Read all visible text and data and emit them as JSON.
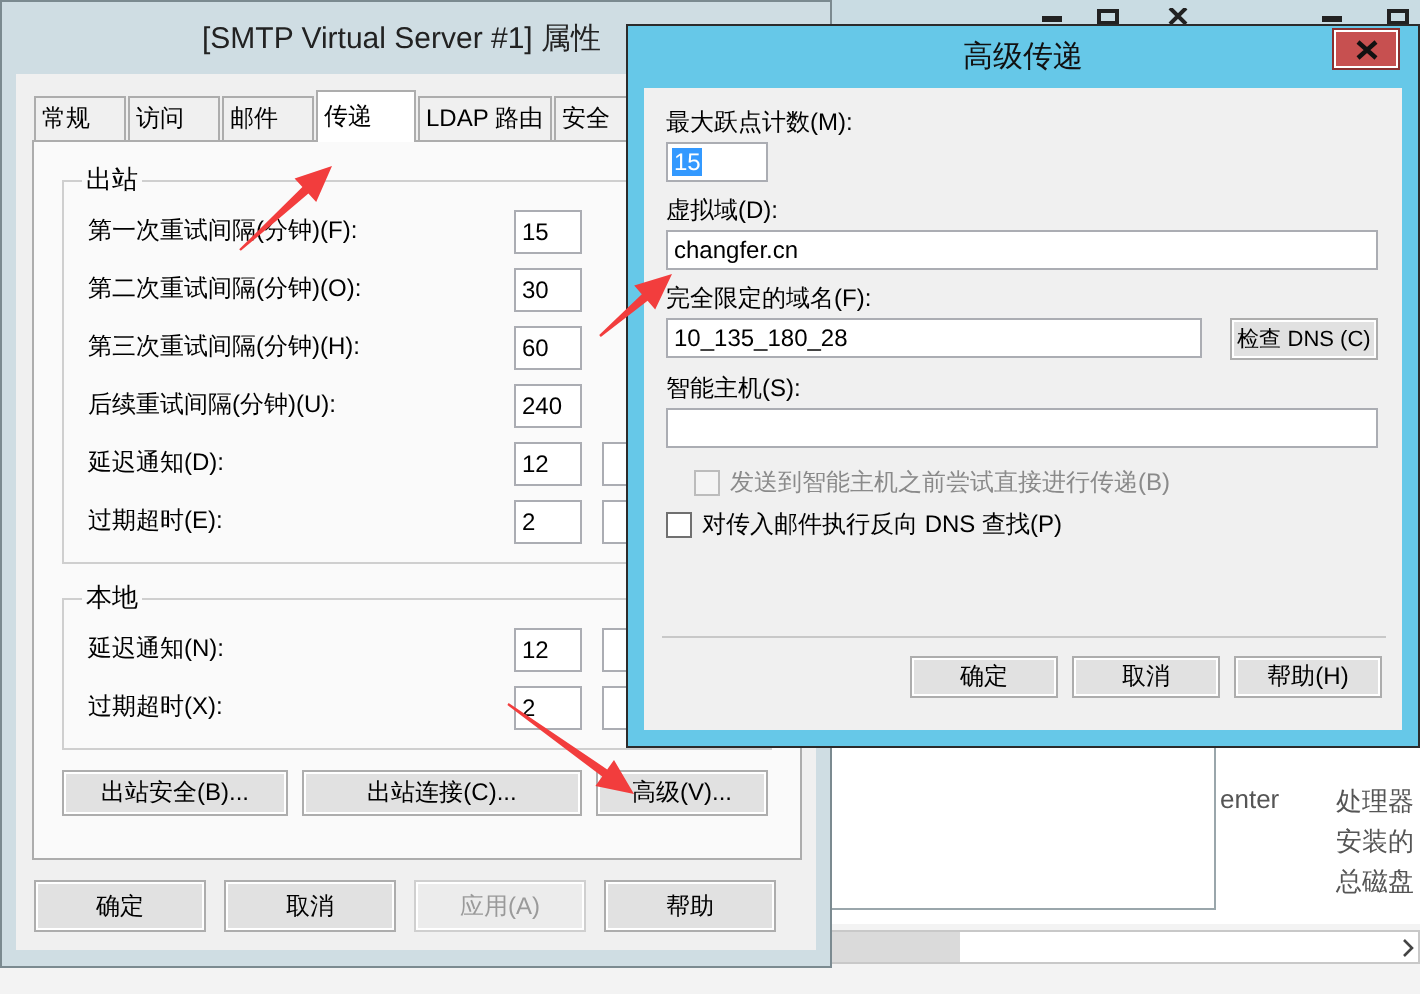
{
  "background_window": {
    "texts": [
      "enter",
      "处理器",
      "安装的",
      "总磁盘"
    ]
  },
  "properties_dialog": {
    "title": "[SMTP Virtual Server #1] 属性",
    "tabs": [
      {
        "label": "常规",
        "selected": false
      },
      {
        "label": "访问",
        "selected": false
      },
      {
        "label": "邮件",
        "selected": false
      },
      {
        "label": "传递",
        "selected": true
      },
      {
        "label": "LDAP 路由",
        "selected": false
      },
      {
        "label": "安全",
        "selected": false
      }
    ],
    "groups": [
      {
        "title": "出站",
        "rows": [
          {
            "label": "第一次重试间隔(分钟)(F):",
            "value": "15",
            "dropdown": false
          },
          {
            "label": "第二次重试间隔(分钟)(O):",
            "value": "30",
            "dropdown": false
          },
          {
            "label": "第三次重试间隔(分钟)(H):",
            "value": "60",
            "dropdown": false
          },
          {
            "label": "后续重试间隔(分钟)(U):",
            "value": "240",
            "dropdown": false
          },
          {
            "label": "延迟通知(D):",
            "value": "12",
            "dropdown": true
          },
          {
            "label": "过期超时(E):",
            "value": "2",
            "dropdown": true
          }
        ]
      },
      {
        "title": "本地",
        "rows": [
          {
            "label": "延迟通知(N):",
            "value": "12",
            "dropdown": true
          },
          {
            "label": "过期超时(X):",
            "value": "2",
            "dropdown": true
          }
        ]
      }
    ],
    "panel_buttons": [
      "出站安全(B)...",
      "出站连接(C)...",
      "高级(V)..."
    ],
    "buttons": [
      {
        "label": "确定",
        "disabled": false
      },
      {
        "label": "取消",
        "disabled": false
      },
      {
        "label": "应用(A)",
        "disabled": true
      },
      {
        "label": "帮助",
        "disabled": false
      }
    ]
  },
  "advanced_dialog": {
    "title": "高级传递",
    "fields": [
      {
        "label": "最大跃点计数(M):",
        "value": "15",
        "kind": "short",
        "highlighted": true
      },
      {
        "label": "虚拟域(D):",
        "value": "changfer.cn",
        "kind": "wide",
        "highlighted": false
      },
      {
        "label": "完全限定的域名(F):",
        "value": "10_135_180_28",
        "kind": "with_button",
        "button": "检查 DNS (C)",
        "highlighted": false
      },
      {
        "label": "智能主机(S):",
        "kind": "wide",
        "highlighted": false
      }
    ],
    "checkboxes": [
      {
        "label": "发送到智能主机之前尝试直接进行传递(B)",
        "checked": false,
        "disabled": true
      },
      {
        "label": "对传入邮件执行反向 DNS 查找(P)",
        "checked": false,
        "disabled": false
      }
    ],
    "buttons": [
      "确定",
      "取消",
      "帮助(H)"
    ]
  }
}
